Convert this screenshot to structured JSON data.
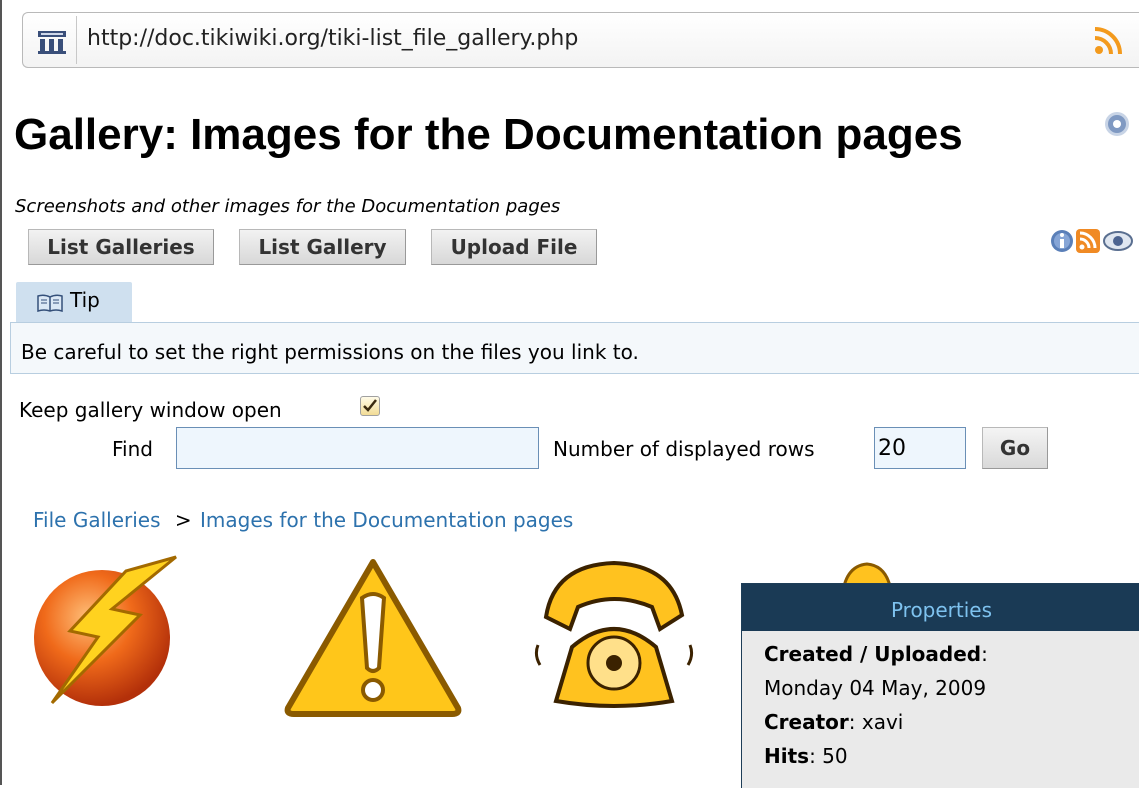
{
  "browser": {
    "url": "http://doc.tikiwiki.org/tiki-list_file_gallery.php",
    "site_icon": "tiki-site-icon",
    "feed_icon": "rss-icon"
  },
  "page": {
    "title": "Gallery: Images for the Documentation pages",
    "description": "Screenshots and other images for the Documentation pages"
  },
  "buttons": {
    "list_galleries": "List Galleries",
    "list_gallery": "List Gallery",
    "upload_file": "Upload File"
  },
  "tip": {
    "tab_label": "Tip",
    "text": "Be careful to set the right permissions on the files you link to."
  },
  "options": {
    "keep_window_label": "Keep gallery window open",
    "keep_window_checked": true,
    "find_label": "Find",
    "find_value": "",
    "rows_label": "Number of displayed rows",
    "rows_value": "20",
    "go_label": "Go"
  },
  "breadcrumb": {
    "root": "File Galleries",
    "separator": ">",
    "current": "Images for the Documentation pages"
  },
  "thumbnails": [
    "lightning-icon",
    "warning-icon",
    "telephone-icon",
    "bell-icon"
  ],
  "properties": {
    "header": "Properties",
    "created_label": "Created / Uploaded",
    "created_value": "Monday 04 May, 2009",
    "creator_label": "Creator",
    "creator_value": "xavi",
    "hits_label": "Hits",
    "hits_value": "50"
  },
  "colors": {
    "link": "#2d72ad",
    "tip_tab": "#cfe0ef",
    "props_header_bg": "#1a3a55",
    "props_header_text": "#7ec2ef"
  }
}
